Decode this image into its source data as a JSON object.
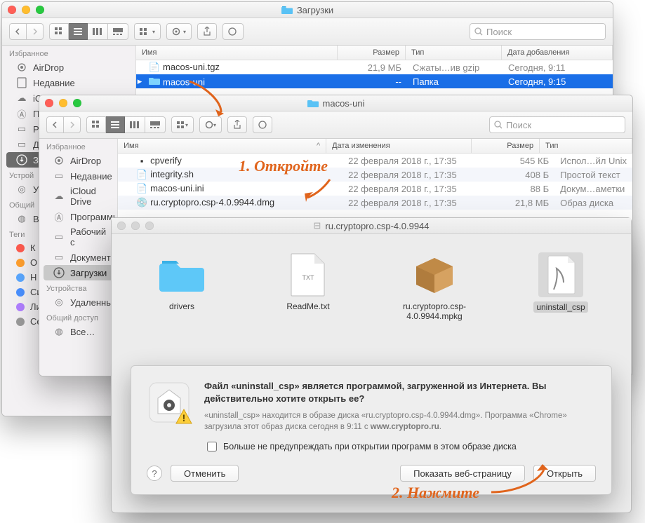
{
  "win1": {
    "title": "Загрузки",
    "search_placeholder": "Поиск",
    "sidebar": {
      "favorites_h": "Избранное",
      "items": [
        {
          "label": "AirDrop"
        },
        {
          "label": "Недавние"
        },
        {
          "label": "iC"
        },
        {
          "label": "П"
        },
        {
          "label": "Р"
        },
        {
          "label": "Д"
        },
        {
          "label": "З"
        }
      ],
      "devices_h": "Устрой",
      "dev": "У",
      "shared_h": "Общий",
      "shared": "В",
      "tags_h": "Теги",
      "tags": [
        {
          "label": "К",
          "color": "#ff5b4f"
        },
        {
          "label": "О",
          "color": "#ff9f2e"
        },
        {
          "label": "Н",
          "color": "#5aa7ff"
        },
        {
          "label": "Синий",
          "color": "#4a90ff"
        },
        {
          "label": "Лиловый",
          "color": "#b07fff"
        },
        {
          "label": "Серый",
          "color": "#9a9a9a"
        }
      ]
    },
    "cols": {
      "name": "Имя",
      "size": "Размер",
      "kind": "Тип",
      "date": "Дата добавления"
    },
    "rows": [
      {
        "name": "macos-uni.tgz",
        "size": "21,9 МБ",
        "kind": "Сжаты…ив gzip",
        "date": "Сегодня, 9:11",
        "icon": "file"
      },
      {
        "name": "macos-uni",
        "size": "--",
        "kind": "Папка",
        "date": "Сегодня, 9:15",
        "icon": "folder",
        "selected": true
      }
    ]
  },
  "win2": {
    "title": "macos-uni",
    "search_placeholder": "Поиск",
    "sidebar": {
      "favorites_h": "Избранное",
      "items": [
        {
          "label": "AirDrop"
        },
        {
          "label": "Недавние"
        },
        {
          "label": "iCloud Drive"
        },
        {
          "label": "Программы"
        },
        {
          "label": "Рабочий с"
        },
        {
          "label": "Документ"
        },
        {
          "label": "Загрузки"
        }
      ],
      "devices_h": "Устройства",
      "dev": "Удаленны",
      "shared_h": "Общий доступ",
      "shared": "Все…"
    },
    "cols": {
      "name": "Имя",
      "date": "Дата изменения",
      "size": "Размер",
      "kind": "Тип"
    },
    "rows": [
      {
        "name": "cpverify",
        "date": "22 февраля 2018 г., 17:35",
        "size": "545 КБ",
        "kind": "Испол…йл Unix"
      },
      {
        "name": "integrity.sh",
        "date": "22 февраля 2018 г., 17:35",
        "size": "408 Б",
        "kind": "Простой текст"
      },
      {
        "name": "macos-uni.ini",
        "date": "22 февраля 2018 г., 17:35",
        "size": "88 Б",
        "kind": "Докум…аметки"
      },
      {
        "name": "ru.cryptopro.csp-4.0.9944.dmg",
        "date": "22 февраля 2018 г., 17:35",
        "size": "21,8 МБ",
        "kind": "Образ диска"
      }
    ]
  },
  "win3": {
    "title": "ru.cryptopro.csp-4.0.9944",
    "items": [
      {
        "label": "drivers",
        "icon": "folder"
      },
      {
        "label": "ReadMe.txt",
        "icon": "txt"
      },
      {
        "label": "ru.cryptopro.csp-4.0.9944.mpkg",
        "icon": "pkg"
      },
      {
        "label": "uninstall_csp",
        "icon": "scpt",
        "selected": true
      }
    ],
    "dialog": {
      "bold": "Файл «uninstall_csp» является программой, загруженной из Интернета. Вы действительно хотите открыть ее?",
      "muted_a": "«uninstall_csp» находится в образе диска «ru.cryptopro.csp-4.0.9944.dmg». Программа «Chrome» загрузила этот образ диска сегодня в 9:11 с ",
      "muted_b": "www.cryptopro.ru",
      "muted_c": ".",
      "checkbox": "Больше не предупреждать при открытии программ в этом образе диска",
      "cancel": "Отменить",
      "show": "Показать веб-страницу",
      "open": "Открыть",
      "help": "?"
    }
  },
  "anno": {
    "a1": "1. Откройте",
    "a2": "2. Нажмите"
  }
}
